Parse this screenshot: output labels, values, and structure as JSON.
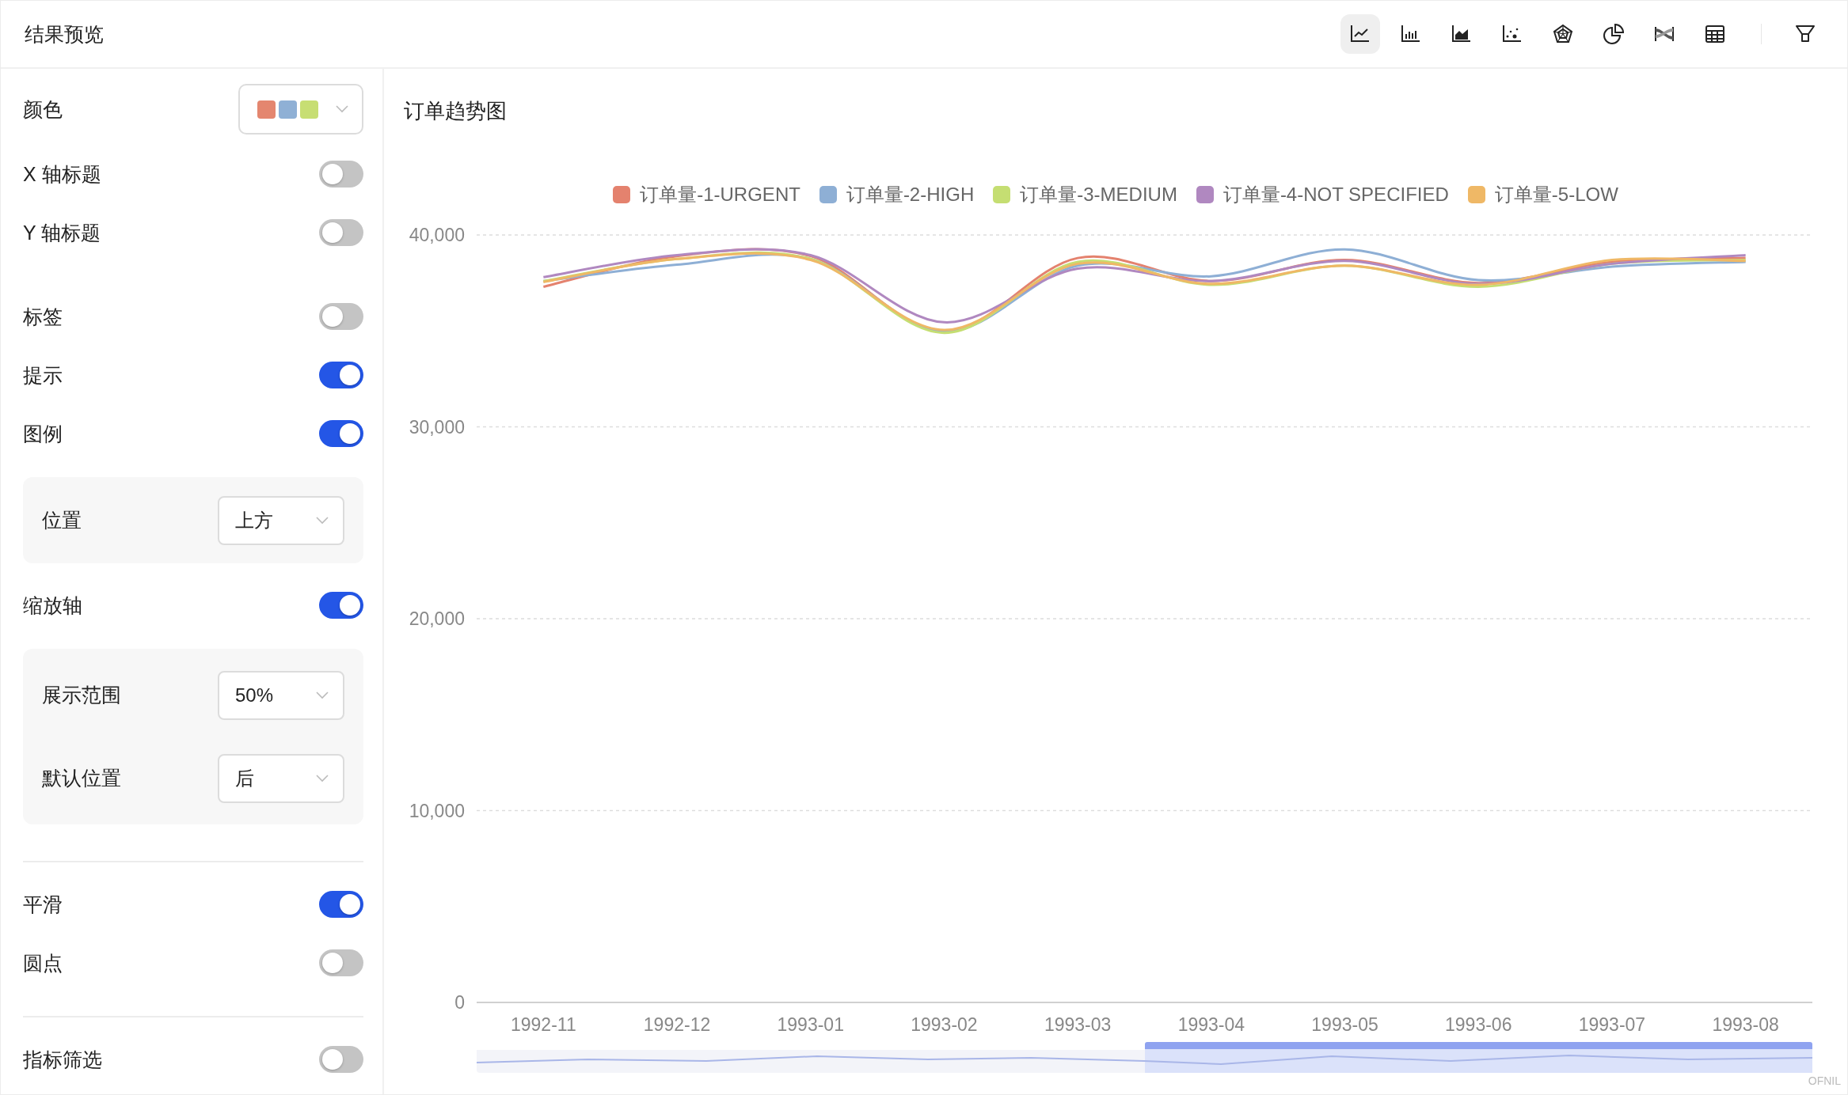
{
  "header": {
    "title": "结果预览",
    "chart_types": [
      {
        "kind": "line",
        "selected": true
      },
      {
        "kind": "bar",
        "selected": false
      },
      {
        "kind": "area",
        "selected": false
      },
      {
        "kind": "scatter",
        "selected": false
      },
      {
        "kind": "radar",
        "selected": false
      },
      {
        "kind": "pie",
        "selected": false
      },
      {
        "kind": "sankey",
        "selected": false
      },
      {
        "kind": "table",
        "selected": false
      }
    ]
  },
  "settings": [
    {
      "divider_above": false,
      "items": [
        {
          "kind": "color",
          "label": "颜色",
          "swatches": [
            {
              "color": "#e4866f"
            },
            {
              "color": "#8fb0d5"
            },
            {
              "color": "#c7de73"
            }
          ]
        },
        {
          "kind": "toggle",
          "label": "X 轴标题",
          "on": false
        },
        {
          "kind": "toggle",
          "label": "Y 轴标题",
          "on": false
        }
      ]
    },
    {
      "divider_above": false,
      "items": [
        {
          "kind": "toggle",
          "label": "标签",
          "on": false
        },
        {
          "kind": "toggle",
          "label": "提示",
          "on": true
        },
        {
          "kind": "toggle",
          "label": "图例",
          "on": true,
          "options": [
            {
              "label": "位置",
              "value": "上方"
            }
          ]
        },
        {
          "kind": "toggle",
          "label": "缩放轴",
          "on": true,
          "options": [
            {
              "label": "展示范围",
              "value": "50%"
            },
            {
              "label": "默认位置",
              "value": "后"
            }
          ]
        }
      ]
    },
    {
      "divider_above": true,
      "items": [
        {
          "kind": "toggle",
          "label": "平滑",
          "on": true
        },
        {
          "kind": "toggle",
          "label": "圆点",
          "on": false
        }
      ]
    },
    {
      "divider_above": true,
      "items": [
        {
          "kind": "toggle",
          "label": "指标筛选",
          "on": false
        }
      ]
    }
  ],
  "chart": {
    "title": "订单趋势图",
    "data_zoom": {
      "level": 0.5
    },
    "corner_mark": "OFNIL",
    "chart_data": {
      "type": "line",
      "grid": true,
      "categories": [
        "1992-11",
        "1992-12",
        "1993-01",
        "1993-02",
        "1993-03",
        "1993-04",
        "1993-05",
        "1993-06",
        "1993-07",
        "1993-08"
      ],
      "ylim": [
        0,
        40000
      ],
      "yticks": [
        {
          "value": 0,
          "label": "0"
        },
        {
          "value": 10000,
          "label": "10,000"
        },
        {
          "value": 20000,
          "label": "20,000"
        },
        {
          "value": 30000,
          "label": "30,000"
        },
        {
          "value": 40000,
          "label": "40,000"
        }
      ],
      "series": [
        {
          "name": "订单量-1-URGENT",
          "color": "#e4826e",
          "values": [
            37300,
            38900,
            38900,
            34950,
            38800,
            37600,
            38700,
            37500,
            38600,
            38800
          ]
        },
        {
          "name": "订单量-2-HIGH",
          "color": "#8eafd5",
          "values": [
            37600,
            38450,
            38750,
            34950,
            38400,
            37850,
            39250,
            37650,
            38350,
            38600
          ]
        },
        {
          "name": "订单量-3-MEDIUM",
          "color": "#c5de72",
          "values": [
            37600,
            38750,
            38750,
            34900,
            38600,
            37400,
            38400,
            37300,
            38500,
            38700
          ]
        },
        {
          "name": "订单量-4-NOT SPECIFIED",
          "color": "#b088c0",
          "values": [
            37800,
            38950,
            38950,
            35450,
            38250,
            37600,
            38650,
            37450,
            38500,
            38950
          ]
        },
        {
          "name": "订单量-5-LOW",
          "color": "#efb866",
          "values": [
            37550,
            38750,
            38700,
            35050,
            38500,
            37450,
            38400,
            37400,
            38700,
            38650
          ]
        }
      ]
    }
  }
}
